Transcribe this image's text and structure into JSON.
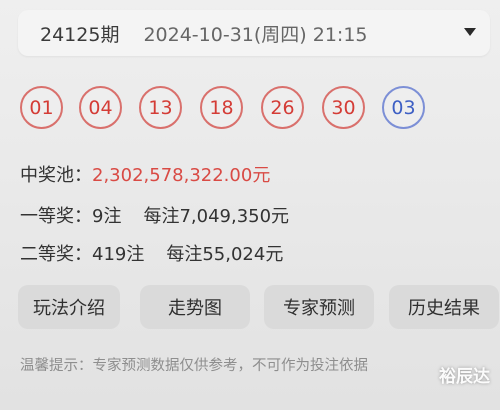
{
  "draw_selector": {
    "issue": "24125期",
    "datetime": "2024-10-31(周四) 21:15",
    "dropdown_icon": "caret-down-icon"
  },
  "numbers": {
    "red": [
      "01",
      "04",
      "13",
      "18",
      "26",
      "30"
    ],
    "blue": "03",
    "colors": {
      "red": "#d43c36",
      "blue": "#3d5fc4"
    }
  },
  "jackpot": {
    "label": "中奖池：",
    "value": "2,302,578,322.00元"
  },
  "prize1": {
    "label": "一等奖：",
    "count": "9注",
    "per_bet": "每注7,049,350元"
  },
  "prize2": {
    "label": "二等奖：",
    "count": "419注",
    "per_bet": "每注55,024元"
  },
  "tabs": [
    "玩法介绍",
    "走势图",
    "专家预测",
    "历史结果"
  ],
  "notice": "温馨提示：专家预测数据仅供参考，不可作为投注依据",
  "watermark": "裕辰达"
}
